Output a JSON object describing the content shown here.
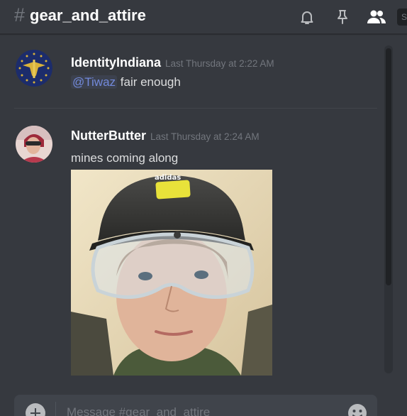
{
  "header": {
    "hash": "#",
    "channel_name": "gear_and_attire",
    "icons": [
      "bell-icon",
      "pin-icon",
      "members-icon",
      "search-icon"
    ]
  },
  "messages": [
    {
      "username": "IdentityIndiana",
      "timestamp": "Last Thursday at 2:22 AM",
      "mention": "@Tiwaz",
      "text": "fair enough"
    },
    {
      "username": "NutterButter",
      "timestamp": "Last Thursday at 2:24 AM",
      "text": "mines coming along",
      "attachment_brand": "adidas"
    }
  ],
  "composer": {
    "placeholder": "Message #gear_and_attire"
  },
  "colors": {
    "background": "#36393f",
    "mention": "#7289da",
    "username": "#ffffff",
    "timestamp": "#72767d"
  }
}
